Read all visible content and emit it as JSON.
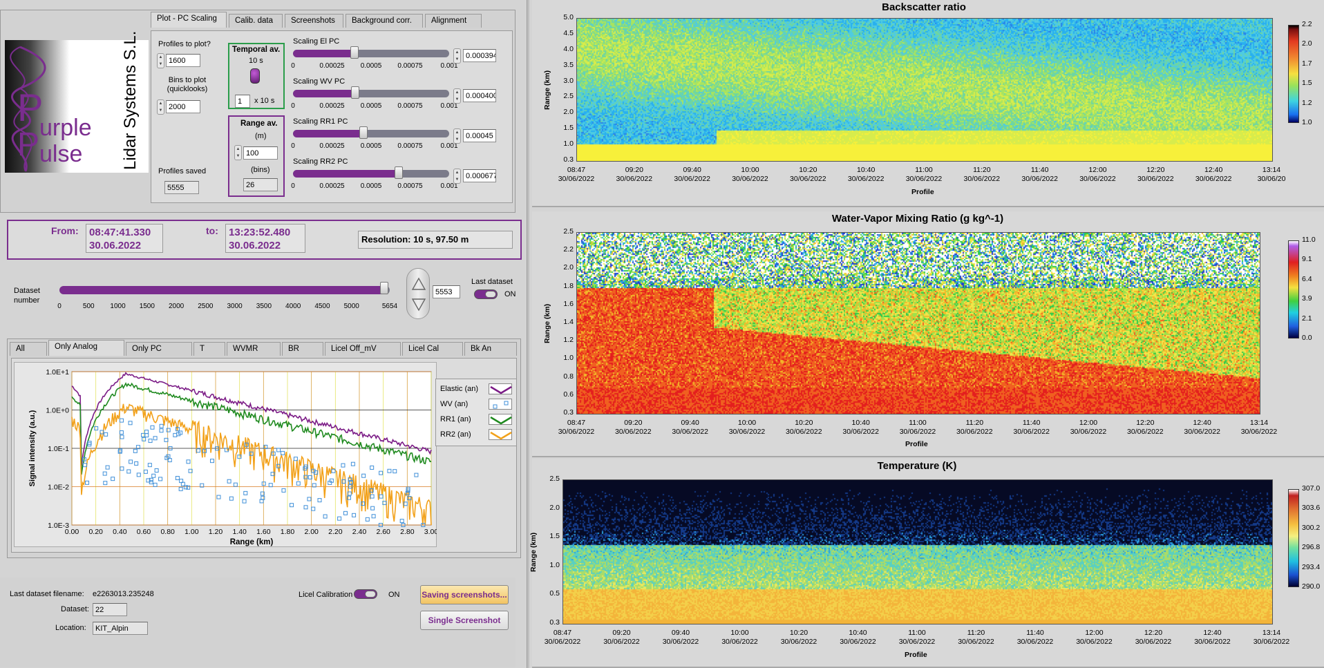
{
  "logo": {
    "text1": "urple",
    "text2": "ulse",
    "company": "Lidar Systems S.L."
  },
  "config_tabs": [
    {
      "label": "Plot - PC Scaling",
      "active": true
    },
    {
      "label": "Calib. data",
      "active": false
    },
    {
      "label": "Screenshots",
      "active": false
    },
    {
      "label": "Background corr.",
      "active": false
    },
    {
      "label": "Alignment",
      "active": false
    }
  ],
  "config": {
    "profiles_label": "Profiles to plot?",
    "profiles_value": "1600",
    "bins_label": "Bins to plot (quicklooks)",
    "bins_value": "2000",
    "saved_label": "Profiles saved",
    "saved_value": "5555",
    "temporal_label": "Temporal av.",
    "temporal_sub": "10 s",
    "temporal_value": "1",
    "temporal_unit": "x 10 s",
    "range_label": "Range av.",
    "range_unit_m": "(m)",
    "range_value_m": "100",
    "range_unit_bins": "(bins)",
    "range_value_bins": "26"
  },
  "scalings": [
    {
      "label": "Scaling El PC",
      "value": "0.000394",
      "level": 0.394
    },
    {
      "label": "Scaling WV PC",
      "value": "0.000400",
      "level": 0.4
    },
    {
      "label": "Scaling RR1 PC",
      "value": "0.00045",
      "level": 0.45
    },
    {
      "label": "Scaling RR2 PC",
      "value": "0.000677",
      "level": 0.677
    }
  ],
  "scaling_ticks": [
    "0",
    "0.00025",
    "0.0005",
    "0.00075",
    "0.001"
  ],
  "time_range": {
    "from_label": "From:",
    "from_time": "08:47:41.330",
    "from_date": "30.06.2022",
    "to_label": "to:",
    "to_time": "13:23:52.480",
    "to_date": "30.06.2022",
    "resolution": "Resolution: 10 s, 97.50 m"
  },
  "dataset": {
    "label": "Dataset number",
    "value": "5553",
    "level": 0.983,
    "ticks": [
      "0",
      "500",
      "1000",
      "1500",
      "2000",
      "2500",
      "3000",
      "3500",
      "4000",
      "4500",
      "5000",
      "5654"
    ],
    "last_label": "Last dataset",
    "last_state": "ON"
  },
  "signal_tabs": [
    {
      "label": "All",
      "active": false
    },
    {
      "label": "Only Analog",
      "active": true
    },
    {
      "label": "Only PC",
      "active": false
    },
    {
      "label": "T",
      "active": false
    },
    {
      "label": "WVMR",
      "active": false
    },
    {
      "label": "BR",
      "active": false
    },
    {
      "label": "Licel Off_mV",
      "active": false
    },
    {
      "label": "Licel Cal",
      "active": false
    },
    {
      "label": "Bk An",
      "active": false
    }
  ],
  "signal_plot": {
    "ylabel": "Signal intensity (a.u.)",
    "xlabel": "Range (km)",
    "yticks": [
      "1.0E+1",
      "1.0E+0",
      "1.0E-1",
      "1.0E-2",
      "1.0E-3"
    ],
    "xticks": [
      "0.00",
      "0.20",
      "0.40",
      "0.60",
      "0.80",
      "1.00",
      "1.20",
      "1.40",
      "1.60",
      "1.80",
      "2.00",
      "2.20",
      "2.40",
      "2.60",
      "2.80",
      "3.00"
    ],
    "legend": [
      {
        "name": "Elastic (an)",
        "color": "#7b1b86"
      },
      {
        "name": "WV (an)",
        "color": "#3f8fd8"
      },
      {
        "name": "RR1 (an)",
        "color": "#1f8a1f"
      },
      {
        "name": "RR2 (an)",
        "color": "#f2a11a"
      }
    ]
  },
  "bottom": {
    "filename_label": "Last dataset filename:",
    "filename_value": "e2263013.235248",
    "dataset_label": "Dataset:",
    "dataset_value": "22",
    "location_label": "Location:",
    "location_value": "KIT_Alpin",
    "licel_label": "Licel Calibration",
    "licel_state": "ON",
    "save_btn": "Saving screenshots...",
    "single_btn": "Single Screenshot"
  },
  "plots": [
    {
      "title": "Backscatter ratio",
      "ylabel": "Range (km)",
      "xlabel": "Profile",
      "yticks": [
        "5.0",
        "4.5",
        "4.0",
        "3.5",
        "3.0",
        "2.5",
        "2.0",
        "1.5",
        "1.0",
        "0.3"
      ],
      "xticks": [
        {
          "t": "08:47",
          "d": "30/06/2022"
        },
        {
          "t": "09:20",
          "d": "30/06/2022"
        },
        {
          "t": "09:40",
          "d": "30/06/2022"
        },
        {
          "t": "10:00",
          "d": "30/06/2022"
        },
        {
          "t": "10:20",
          "d": "30/06/2022"
        },
        {
          "t": "10:40",
          "d": "30/06/2022"
        },
        {
          "t": "11:00",
          "d": "30/06/2022"
        },
        {
          "t": "11:20",
          "d": "30/06/2022"
        },
        {
          "t": "11:40",
          "d": "30/06/2022"
        },
        {
          "t": "12:00",
          "d": "30/06/2022"
        },
        {
          "t": "12:20",
          "d": "30/06/2022"
        },
        {
          "t": "12:40",
          "d": "30/06/2022"
        },
        {
          "t": "13:14",
          "d": "30/06/20"
        }
      ],
      "cbar": [
        "2.2",
        "2.0",
        "1.7",
        "1.5",
        "1.2",
        "1.0"
      ]
    },
    {
      "title": "Water-Vapor Mixing Ratio  (g kg^-1)",
      "ylabel": "Range (km)",
      "xlabel": "Profile",
      "yticks": [
        "2.5",
        "2.2",
        "2.0",
        "1.8",
        "1.6",
        "1.4",
        "1.2",
        "1.0",
        "0.8",
        "0.6",
        "0.3"
      ],
      "xticks": [
        {
          "t": "08:47",
          "d": "30/06/2022"
        },
        {
          "t": "09:20",
          "d": "30/06/2022"
        },
        {
          "t": "09:40",
          "d": "30/06/2022"
        },
        {
          "t": "10:00",
          "d": "30/06/2022"
        },
        {
          "t": "10:20",
          "d": "30/06/2022"
        },
        {
          "t": "10:40",
          "d": "30/06/2022"
        },
        {
          "t": "11:00",
          "d": "30/06/2022"
        },
        {
          "t": "11:20",
          "d": "30/06/2022"
        },
        {
          "t": "11:40",
          "d": "30/06/2022"
        },
        {
          "t": "12:00",
          "d": "30/06/2022"
        },
        {
          "t": "12:20",
          "d": "30/06/2022"
        },
        {
          "t": "12:40",
          "d": "30/06/2022"
        },
        {
          "t": "13:14",
          "d": "30/06/2022"
        }
      ],
      "cbar": [
        "11.0",
        "9.1",
        "6.4",
        "3.9",
        "2.1",
        "0.0"
      ]
    },
    {
      "title": "Temperature (K)",
      "ylabel": "Range (km)",
      "xlabel": "Profile",
      "yticks": [
        "2.5",
        "2.0",
        "1.5",
        "1.0",
        "0.5",
        "0.3"
      ],
      "xticks": [
        {
          "t": "08:47",
          "d": "30/06/2022"
        },
        {
          "t": "09:20",
          "d": "30/06/2022"
        },
        {
          "t": "09:40",
          "d": "30/06/2022"
        },
        {
          "t": "10:00",
          "d": "30/06/2022"
        },
        {
          "t": "10:20",
          "d": "30/06/2022"
        },
        {
          "t": "10:40",
          "d": "30/06/2022"
        },
        {
          "t": "11:00",
          "d": "30/06/2022"
        },
        {
          "t": "11:20",
          "d": "30/06/2022"
        },
        {
          "t": "11:40",
          "d": "30/06/2022"
        },
        {
          "t": "12:00",
          "d": "30/06/2022"
        },
        {
          "t": "12:20",
          "d": "30/06/2022"
        },
        {
          "t": "12:40",
          "d": "30/06/2022"
        },
        {
          "t": "13:14",
          "d": "30/06/2022"
        }
      ],
      "cbar": [
        "307.0",
        "303.6",
        "300.2",
        "296.8",
        "293.4",
        "290.0"
      ]
    }
  ]
}
